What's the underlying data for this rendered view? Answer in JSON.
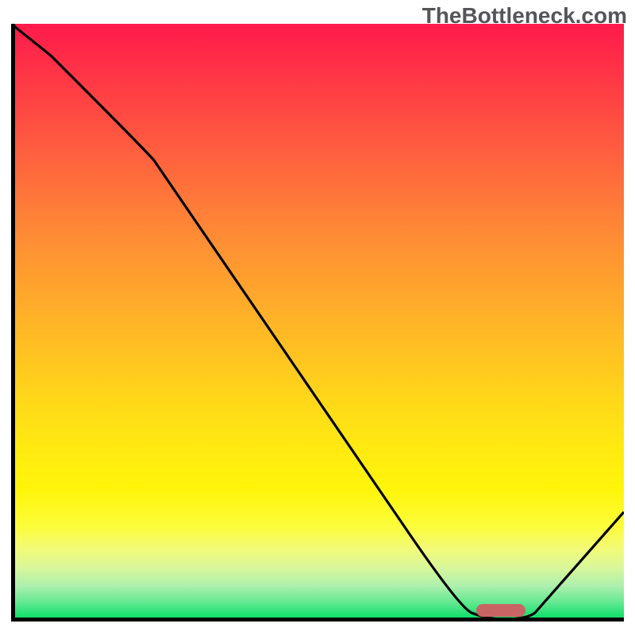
{
  "watermark": "TheBottleneck.com",
  "chart_data": {
    "type": "line",
    "title": "",
    "xlabel": "",
    "ylabel": "",
    "xlim": [
      0,
      100
    ],
    "ylim": [
      0,
      100
    ],
    "x": [
      0,
      5,
      22,
      40,
      58,
      72,
      76,
      82,
      88,
      100
    ],
    "y": [
      100,
      94,
      78,
      54,
      30,
      8,
      2,
      0,
      1,
      18
    ],
    "optimum_range": {
      "x_start": 76,
      "x_end": 84,
      "y": 0
    },
    "grid": false,
    "background": "heat-gradient"
  },
  "colors": {
    "curve": "#000000",
    "marker": "#c96464",
    "axis": "#000000"
  }
}
